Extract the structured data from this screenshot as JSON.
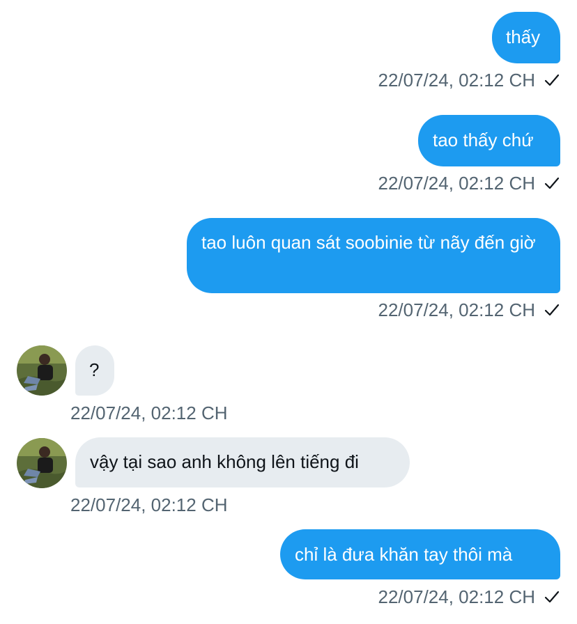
{
  "messages": [
    {
      "text": "thấy",
      "time": "22/07/24, 02:12 CH"
    },
    {
      "text": "tao thấy chứ",
      "time": "22/07/24, 02:12 CH"
    },
    {
      "text": "tao luôn quan sát soobinie từ nãy đến giờ",
      "time": "22/07/24, 02:12 CH"
    },
    {
      "text": "?",
      "time": "22/07/24, 02:12 CH"
    },
    {
      "text": "vậy tại sao anh không lên tiếng đi",
      "time": "22/07/24, 02:12 CH"
    },
    {
      "text": "chỉ là đưa khăn tay thôi mà",
      "time": "22/07/24, 02:12 CH"
    }
  ],
  "colors": {
    "sent_bubble": "#1d9bf0",
    "received_bubble": "#e7ecf0",
    "timestamp": "#536471"
  },
  "icons": {
    "read_receipt": "check-icon",
    "contact_avatar": "avatar"
  }
}
